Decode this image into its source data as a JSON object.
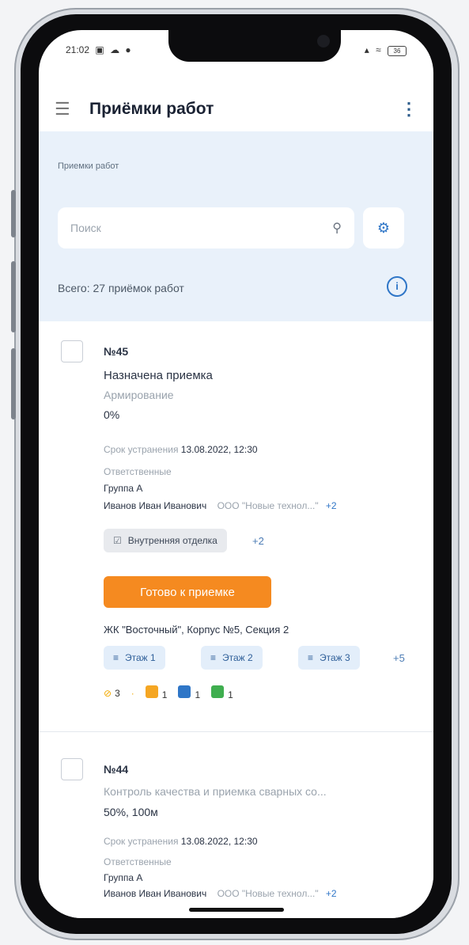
{
  "status": {
    "time": "21:02",
    "battery": "36"
  },
  "appbar": {
    "title": "Приёмки работ"
  },
  "breadcrumb": "Приемки работ",
  "search": {
    "placeholder": "Поиск"
  },
  "summary": "Всего: 27 приёмок работ",
  "cards": [
    {
      "number": "№45",
      "status": "Назначена приемка",
      "type": "Армирование",
      "progress": "0%",
      "deadline_label": "Срок устранения",
      "deadline": "13.08.2022, 12:30",
      "responsible_label": "Ответственные",
      "group": "Группа А",
      "person": "Иванов Иван Иванович",
      "company": "ООО \"Новые технол...\"",
      "company_more": "+2",
      "work_tag": "Внутренняя отделка",
      "work_tag_more": "+2",
      "action_button": "Готово к приемке",
      "location": "ЖК \"Восточный\", Корпус №5, Секция 2",
      "floors": [
        "Этаж 1",
        "Этаж 2",
        "Этаж 3"
      ],
      "floors_more": "+5",
      "counts": [
        {
          "icon": "cancel-icon",
          "color": "#f2a900",
          "value": "3"
        },
        {
          "icon": "document-orange-icon",
          "color": "#f5a623",
          "value": "1"
        },
        {
          "icon": "document-blue-icon",
          "color": "#2f76c7",
          "value": "1"
        },
        {
          "icon": "document-green-icon",
          "color": "#3fae4f",
          "value": "1"
        }
      ]
    },
    {
      "number": "№44",
      "type": "Контроль качества и приемка сварных со...",
      "progress": "50%, 100м",
      "deadline_label": "Срок устранения",
      "deadline": "13.08.2022, 12:30",
      "responsible_label": "Ответственные",
      "group": "Группа А",
      "person": "Иванов Иван Иванович",
      "company": "ООО \"Новые технол...\"",
      "company_more": "+2"
    }
  ]
}
